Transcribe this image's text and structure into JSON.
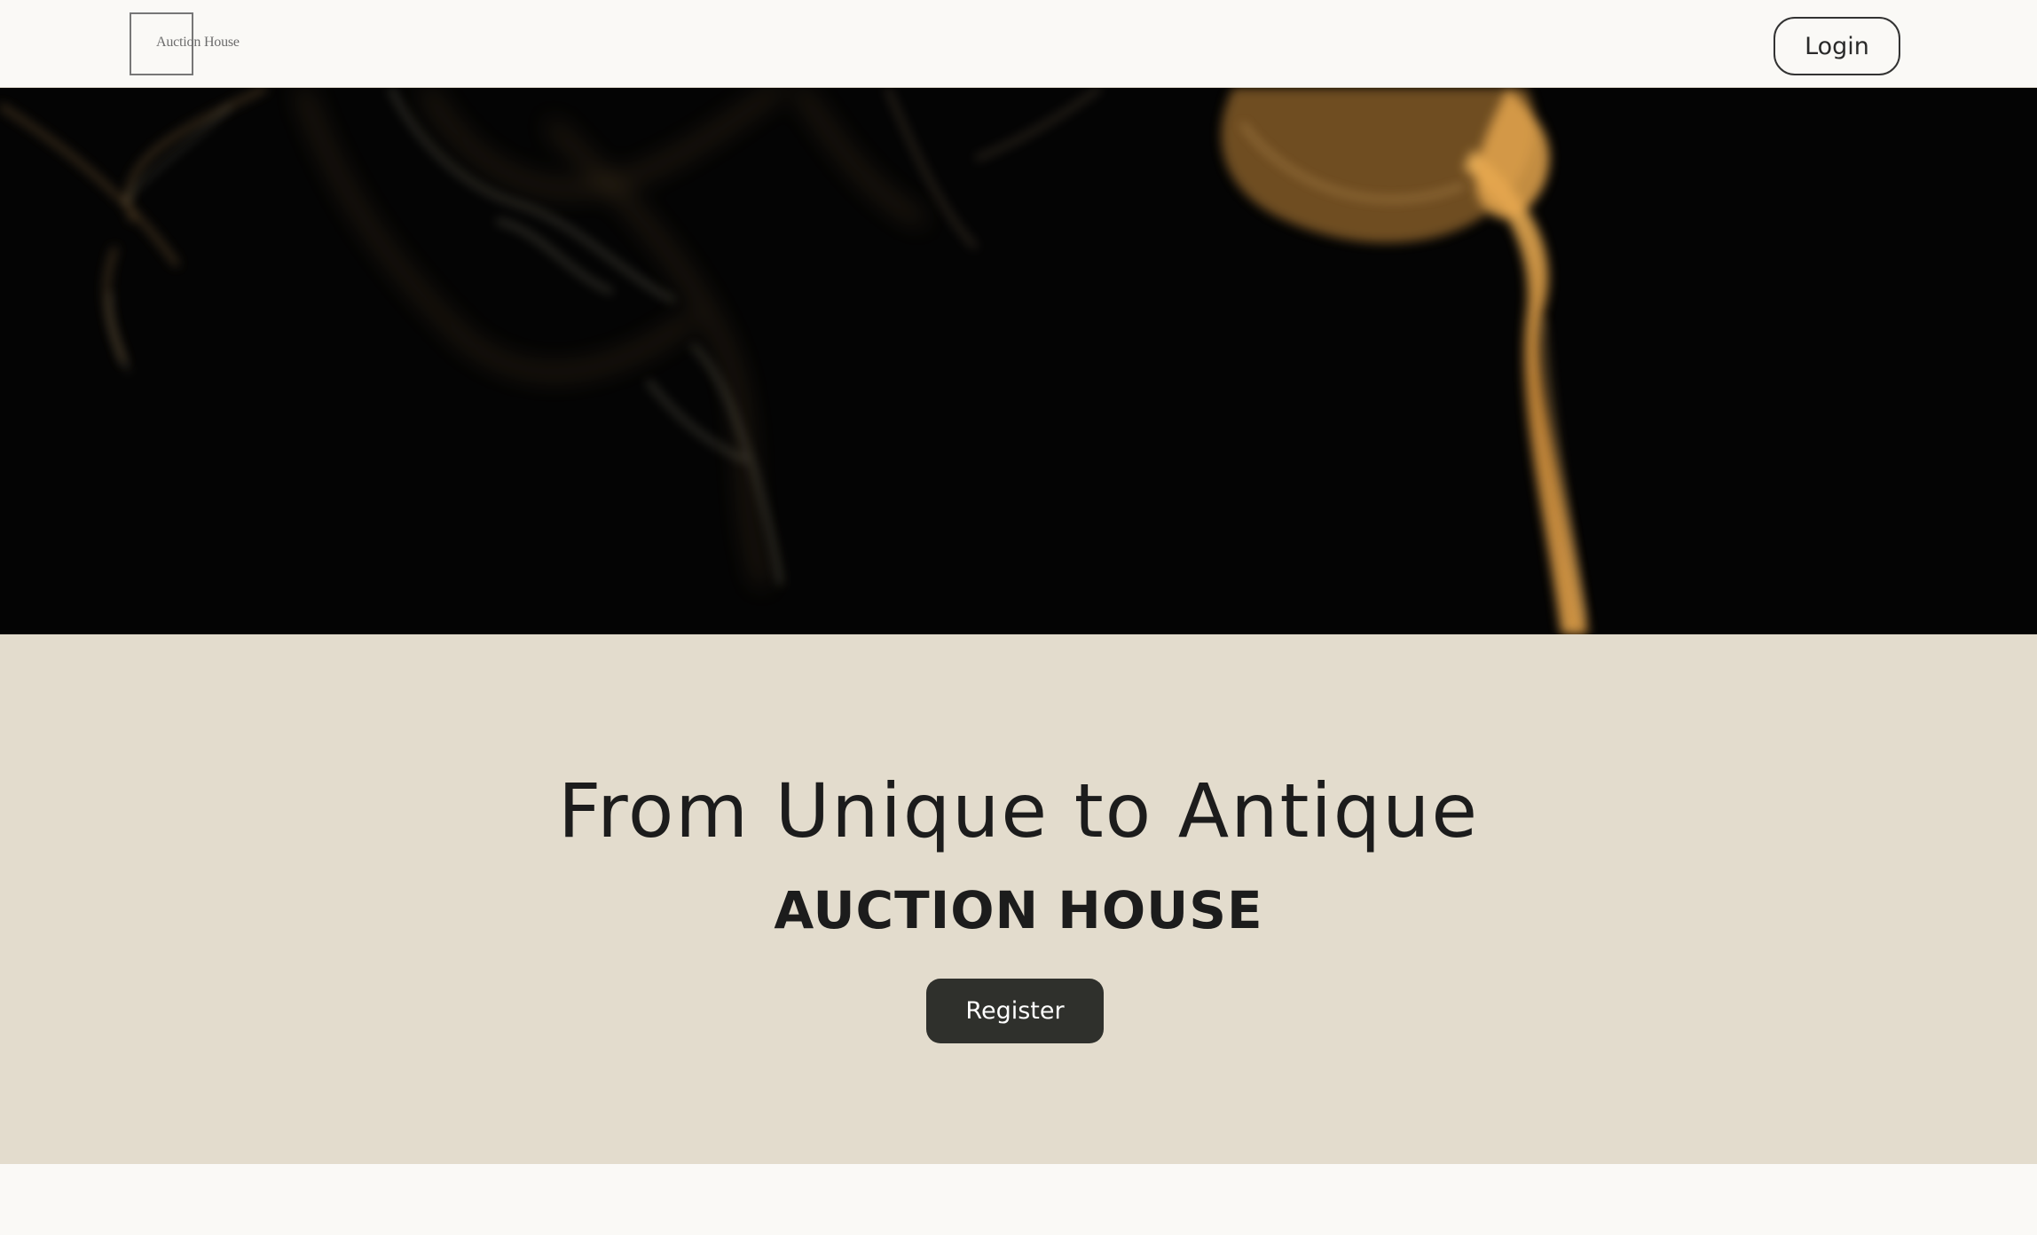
{
  "header": {
    "logo_text": "Auction House",
    "login_label": "Login"
  },
  "hero": {
    "image_icon": "smoke-photo"
  },
  "banner": {
    "tagline": "From Unique to Antique",
    "subtitle": "AUCTION HOUSE",
    "register_label": "Register"
  },
  "colors": {
    "header_bg": "#faf9f6",
    "banner_bg": "#e3dccd",
    "register_bg": "#2f302c",
    "text": "#1c1c1c",
    "smoke": "#d9a450"
  }
}
